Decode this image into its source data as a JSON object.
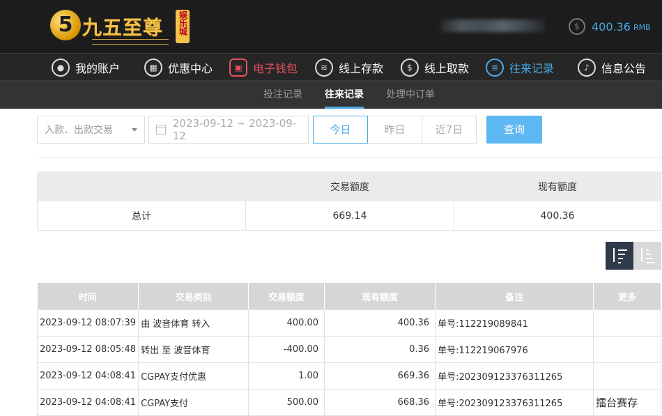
{
  "brand": {
    "logo_glyph": "5",
    "name": "九五至尊",
    "badge": "娱乐城"
  },
  "account": {
    "balance": "400.36",
    "currency": "RMB"
  },
  "nav": {
    "items": [
      {
        "label": "我的账户",
        "icon": "user-icon"
      },
      {
        "label": "优惠中心",
        "icon": "gift-icon"
      },
      {
        "label": "电子钱包",
        "icon": "wallet-icon"
      },
      {
        "label": "线上存款",
        "icon": "deposit-icon"
      },
      {
        "label": "线上取款",
        "icon": "withdraw-icon"
      },
      {
        "label": "往来记录",
        "icon": "records-icon"
      },
      {
        "label": "信息公告",
        "icon": "bell-icon"
      }
    ]
  },
  "subnav": {
    "tabs": [
      "投注记录",
      "往来记录",
      "处理中订单"
    ]
  },
  "filters": {
    "type_placeholder": "入款．出款交易",
    "date_range": "2023-09-12 ~ 2023-09-12",
    "quick": [
      "今日",
      "昨日",
      "近7日"
    ],
    "query_label": "查询"
  },
  "summary": {
    "headers": [
      "",
      "交易额度",
      "现有额度"
    ],
    "row_label": "总计",
    "trade_total": "669.14",
    "current_total": "400.36"
  },
  "table": {
    "headers": [
      "时间",
      "交易类别",
      "交易额度",
      "现有额度",
      "备注",
      "更多"
    ],
    "rows": [
      {
        "time": "2023-09-12 08:07:39",
        "type": "由 波音体育 转入",
        "amount": "400.00",
        "balance": "400.36",
        "note": "单号:112219089841",
        "more": ""
      },
      {
        "time": "2023-09-12 08:05:48",
        "type": "转出 至 波音体育",
        "amount": "-400.00",
        "balance": "0.36",
        "note": "单号:112219067976",
        "more": ""
      },
      {
        "time": "2023-09-12 04:08:41",
        "type": "CGPAY支付优惠",
        "amount": "1.00",
        "balance": "669.36",
        "note": "单号:20230912337631126​5",
        "more": ""
      },
      {
        "time": "2023-09-12 04:08:41",
        "type": "CGPAY支付",
        "amount": "500.00",
        "balance": "668.36",
        "note": "单号:20230912337631126​5",
        "more": "擂台赛存"
      }
    ]
  },
  "colors": {
    "accent_blue": "#4aa8e8",
    "active_red": "#e8505b",
    "gold": "#f3c24a"
  }
}
